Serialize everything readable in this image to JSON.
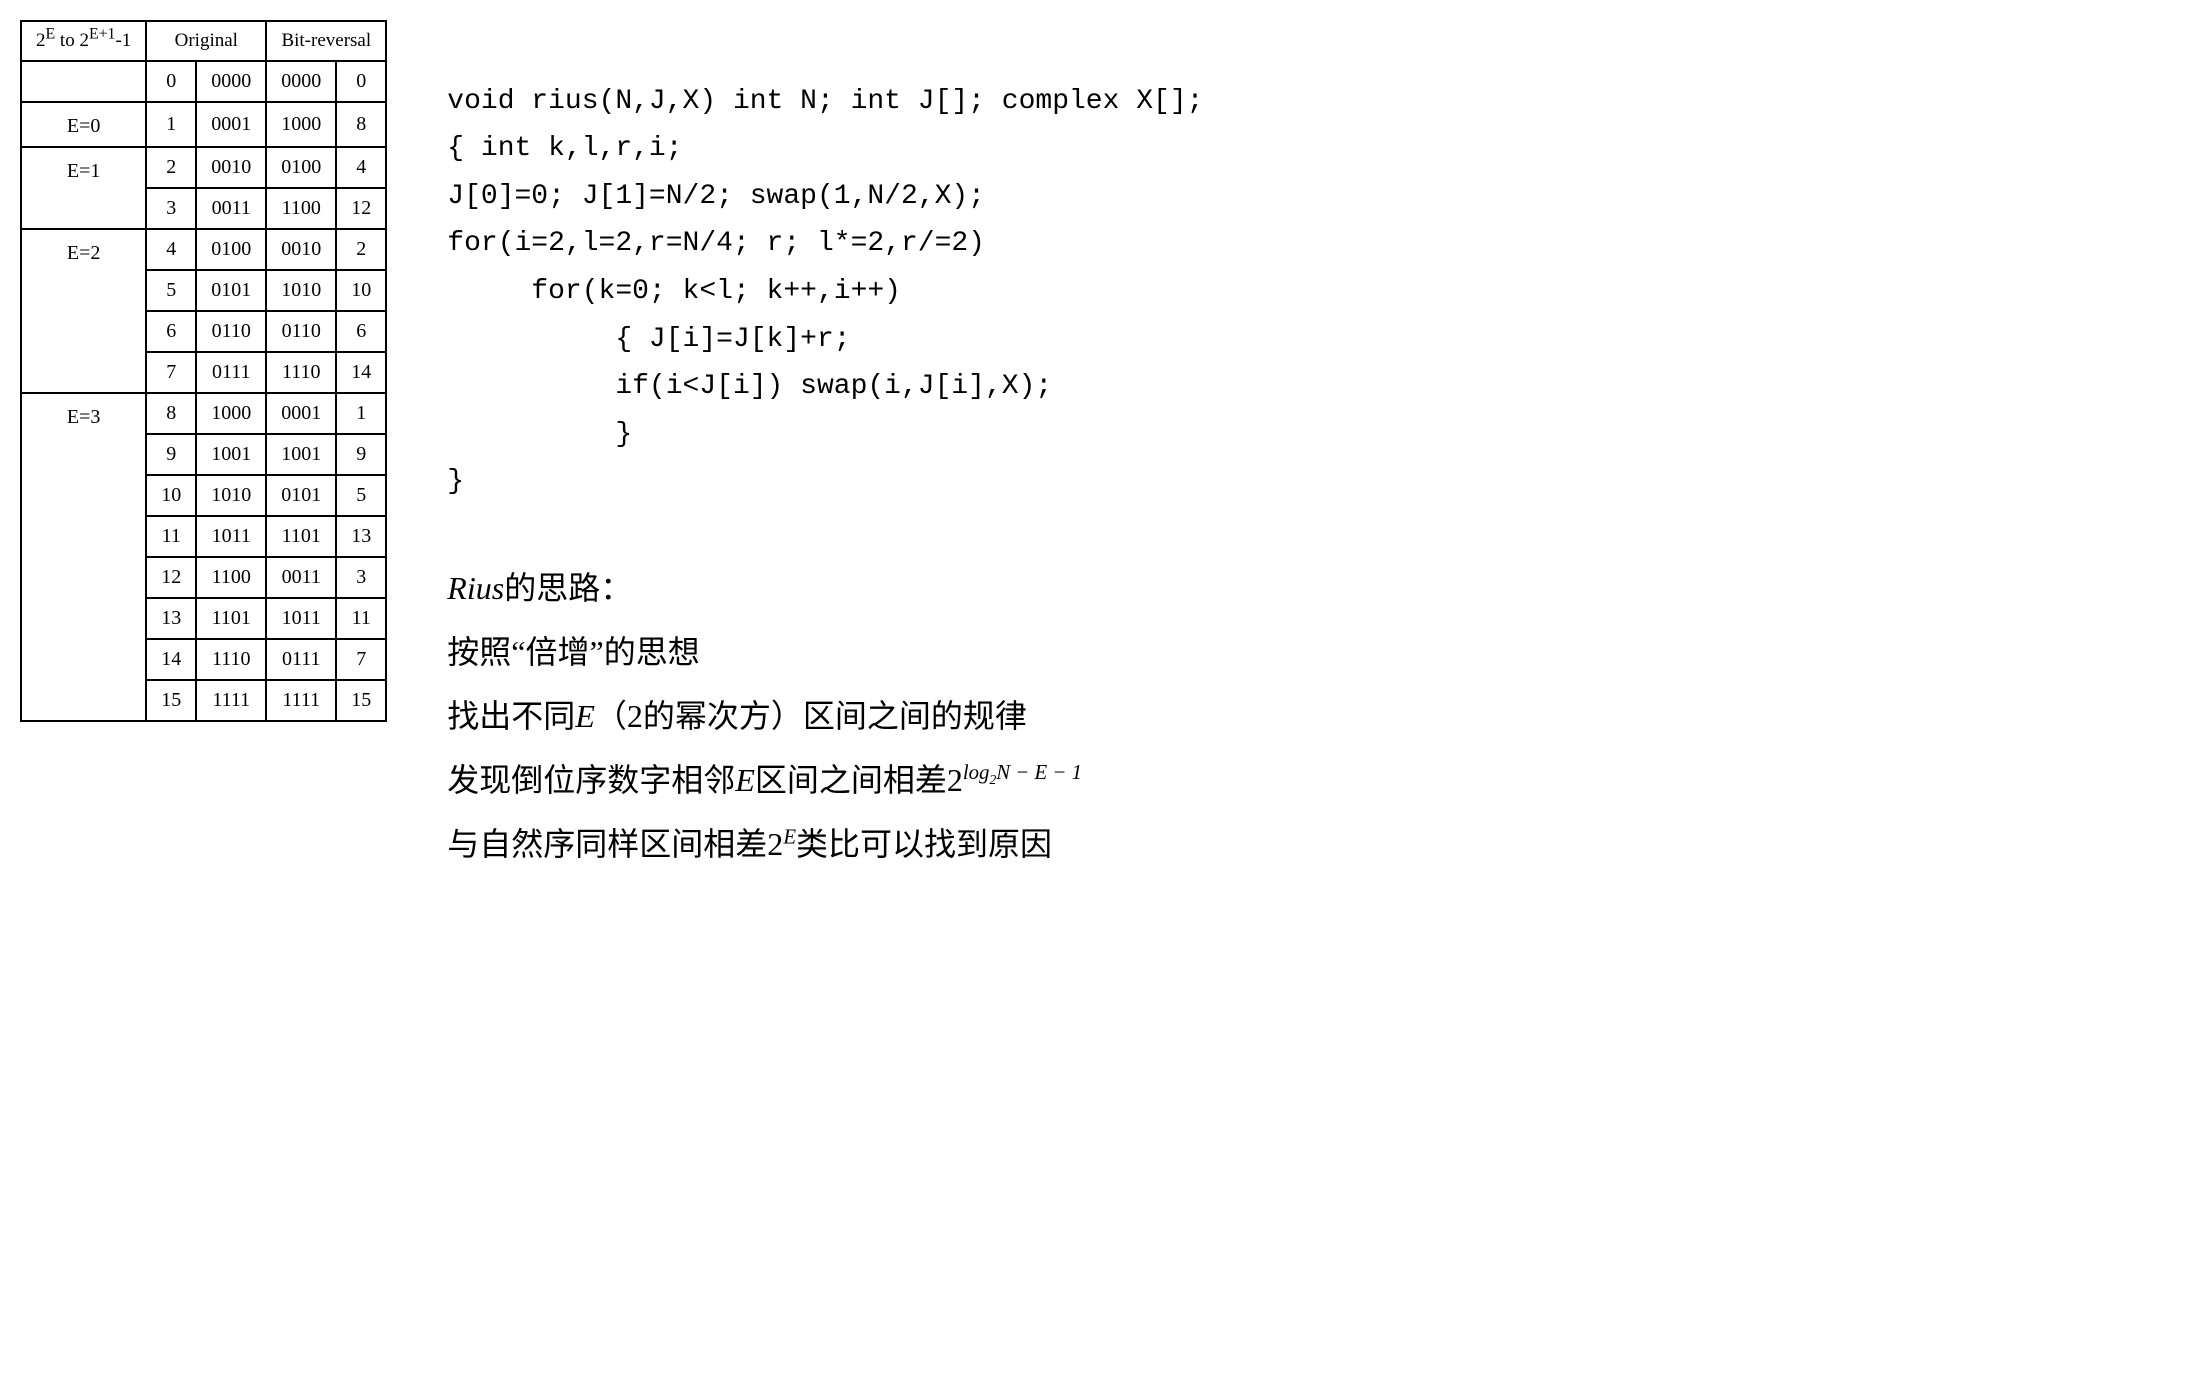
{
  "table": {
    "header": {
      "range_html": "2<sup>E</sup> to 2<sup>E+1</sup>-1",
      "orig": "Original",
      "br": "Bit-reversal"
    },
    "rows": [
      {
        "e": "",
        "n": "0",
        "nb": "0000",
        "rb": "0000",
        "r": "0"
      },
      {
        "e": "E=0",
        "n": "1",
        "nb": "0001",
        "rb": "1000",
        "r": "8"
      },
      {
        "e": "E=1",
        "n": "2",
        "nb": "0010",
        "rb": "0100",
        "r": "4"
      },
      {
        "e": "",
        "n": "3",
        "nb": "0011",
        "rb": "1100",
        "r": "12"
      },
      {
        "e": "E=2",
        "n": "4",
        "nb": "0100",
        "rb": "0010",
        "r": "2"
      },
      {
        "e": "",
        "n": "5",
        "nb": "0101",
        "rb": "1010",
        "r": "10"
      },
      {
        "e": "",
        "n": "6",
        "nb": "0110",
        "rb": "0110",
        "r": "6"
      },
      {
        "e": "",
        "n": "7",
        "nb": "0111",
        "rb": "1110",
        "r": "14"
      },
      {
        "e": "E=3",
        "n": "8",
        "nb": "1000",
        "rb": "0001",
        "r": "1"
      },
      {
        "e": "",
        "n": "9",
        "nb": "1001",
        "rb": "1001",
        "r": "9"
      },
      {
        "e": "",
        "n": "10",
        "nb": "1010",
        "rb": "0101",
        "r": "5"
      },
      {
        "e": "",
        "n": "11",
        "nb": "1011",
        "rb": "1101",
        "r": "13"
      },
      {
        "e": "",
        "n": "12",
        "nb": "1100",
        "rb": "0011",
        "r": "3"
      },
      {
        "e": "",
        "n": "13",
        "nb": "1101",
        "rb": "1011",
        "r": "11"
      },
      {
        "e": "",
        "n": "14",
        "nb": "1110",
        "rb": "0111",
        "r": "7"
      },
      {
        "e": "",
        "n": "15",
        "nb": "1111",
        "rb": "1111",
        "r": "15"
      }
    ],
    "groups": [
      {
        "label": "",
        "span": 1
      },
      {
        "label": "E=0",
        "span": 1
      },
      {
        "label": "E=1",
        "span": 2
      },
      {
        "label": "E=2",
        "span": 4
      },
      {
        "label": "E=3",
        "span": 8
      }
    ]
  },
  "code": {
    "l1": "void rius(N,J,X) int N; int J[]; complex X[];",
    "l2": "{ int k,l,r,i;",
    "l3": "J[0]=0; J[1]=N/2; swap(1,N/2,X);",
    "l4": "for(i=2,l=2,r=N/4; r; l*=2,r/=2)",
    "l5": "     for(k=0; k<l; k++,i++)",
    "l6": "          { J[i]=J[k]+r;",
    "l7": "          if(i<J[i]) swap(i,J[i],X);",
    "l8": "          }",
    "l9": "}"
  },
  "notes": {
    "l1_html": "<span class=\"ital\">Rius</span>的思路：",
    "l2_html": "按照“倍增”的思想",
    "l3_html": "找出不同<span class=\"ital\">E</span>（2的幂次方）区间之间的规律",
    "l4_html": "发现倒位序数字相邻<span class=\"ital\">E</span>区间之间相差2<sup class=\"supexpr\">log<sub>2</sub>N − E − 1</sup>",
    "l5_html": "与自然序同样区间相差2<sup class=\"supexpr\">E</sup>类比可以找到原因"
  }
}
